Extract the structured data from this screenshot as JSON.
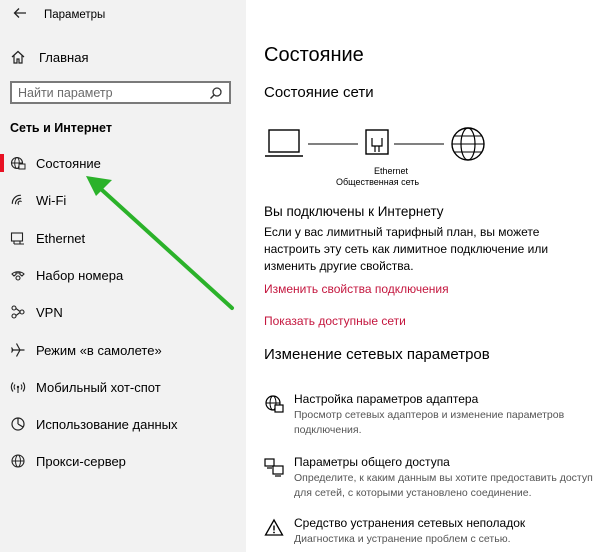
{
  "window": {
    "title": "Параметры"
  },
  "sidebar": {
    "home_label": "Главная",
    "search_placeholder": "Найти параметр",
    "section_title": "Сеть и Интернет",
    "items": [
      {
        "label": "Состояние",
        "icon": "globe-status-icon",
        "active": true
      },
      {
        "label": "Wi-Fi",
        "icon": "wifi-icon"
      },
      {
        "label": "Ethernet",
        "icon": "ethernet-icon"
      },
      {
        "label": "Набор номера",
        "icon": "dialup-icon"
      },
      {
        "label": "VPN",
        "icon": "vpn-icon"
      },
      {
        "label": "Режим «в самолете»",
        "icon": "airplane-icon"
      },
      {
        "label": "Мобильный хот-спот",
        "icon": "hotspot-icon"
      },
      {
        "label": "Использование данных",
        "icon": "data-usage-icon"
      },
      {
        "label": "Прокси-сервер",
        "icon": "proxy-globe-icon"
      }
    ]
  },
  "main": {
    "title": "Состояние",
    "network_status_title": "Состояние сети",
    "diagram": {
      "adapter_name": "Ethernet",
      "network_name": "Общественная сеть"
    },
    "connected_text": "Вы подключены к Интернету",
    "description": "Если у вас лимитный тарифный план, вы можете настроить эту сеть как лимитное подключение или изменить другие свойства.",
    "link_change_properties": "Изменить свойства подключения",
    "link_show_networks": "Показать доступные сети",
    "change_settings_title": "Изменение сетевых параметров",
    "options": [
      {
        "title": "Настройка параметров адаптера",
        "description": "Просмотр сетевых адаптеров и изменение параметров подключения.",
        "icon": "adapter-icon"
      },
      {
        "title": "Параметры общего доступа",
        "description": "Определите, к каким данным вы хотите предоставить доступ для сетей, с которыми установлено соединение.",
        "icon": "sharing-icon"
      },
      {
        "title": "Средство устранения сетевых неполадок",
        "description": "Диагностика и устранение проблем с сетью.",
        "icon": "troubleshoot-icon"
      }
    ]
  },
  "colors": {
    "accent": "#e81123",
    "link": "#c4163e",
    "annotation_arrow": "#2bb22a",
    "sidebar_bg": "#f2f2f2"
  }
}
